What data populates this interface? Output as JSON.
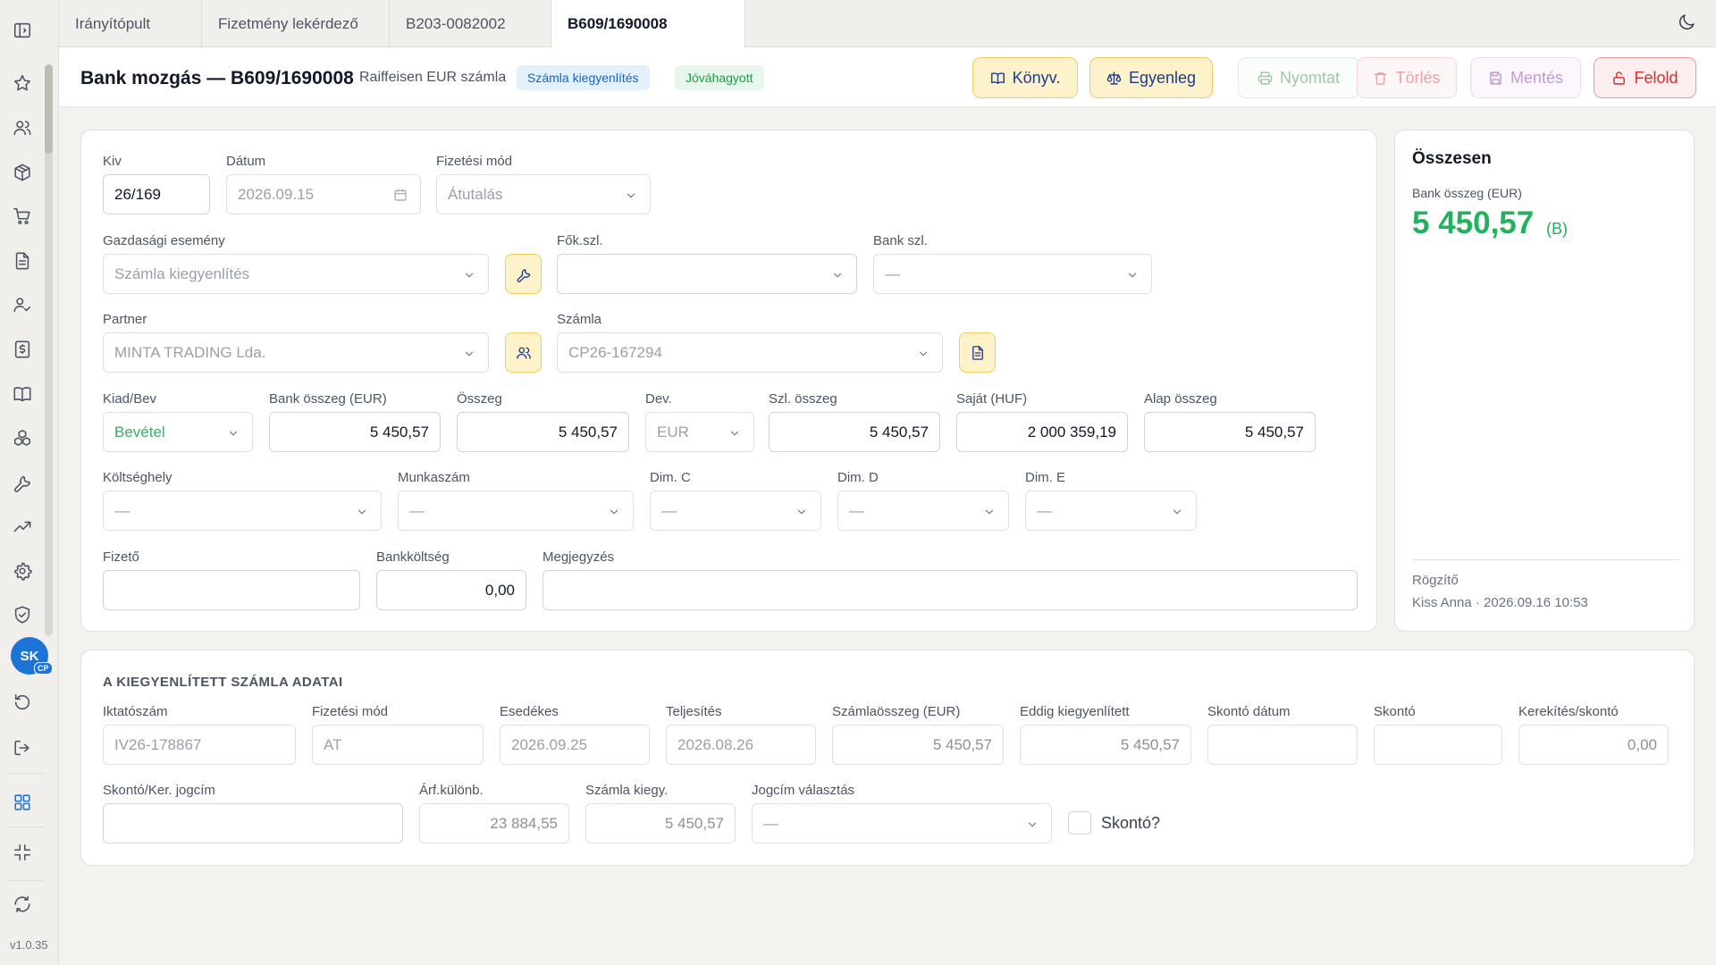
{
  "tabs": [
    "Irányítópult",
    "Fizetmény lekérdező",
    "B203-0082002",
    "B609/1690008"
  ],
  "header": {
    "title": "Bank mozgás — B609/1690008",
    "subtitle": "Raiffeisen EUR számla",
    "badge_type": "Számla kiegyenlítés",
    "badge_status": "Jóváhagyott"
  },
  "actions": {
    "konyv": "Könyv.",
    "egyenleg": "Egyenleg",
    "nyomtat": "Nyomtat",
    "torles": "Törlés",
    "mentes": "Mentés",
    "felold": "Felold"
  },
  "form": {
    "kiv": {
      "label": "Kiv",
      "value": "26/169"
    },
    "datum": {
      "label": "Dátum",
      "value": "2026.09.15"
    },
    "fizmod": {
      "label": "Fizetési mód",
      "value": "Átutalás"
    },
    "gazd": {
      "label": "Gazdasági esemény",
      "value": "Számla kiegyenlítés"
    },
    "fokszl": {
      "label": "Fők.szl.",
      "value": ""
    },
    "bankszl": {
      "label": "Bank szl.",
      "value": "—"
    },
    "partner": {
      "label": "Partner",
      "value": "MINTA TRADING Lda."
    },
    "szamla": {
      "label": "Számla",
      "value": "CP26-167294"
    },
    "kiadbev": {
      "label": "Kiad/Bev",
      "value": "Bevétel"
    },
    "bankosszeg": {
      "label": "Bank összeg (EUR)",
      "value": "5 450,57"
    },
    "osszeg": {
      "label": "Összeg",
      "value": "5 450,57"
    },
    "dev": {
      "label": "Dev.",
      "value": "EUR"
    },
    "szlosszeg": {
      "label": "Szl. összeg",
      "value": "5 450,57"
    },
    "sajat": {
      "label": "Saját (HUF)",
      "value": "2 000 359,19"
    },
    "alaposszeg": {
      "label": "Alap összeg",
      "value": "5 450,57"
    },
    "koltseghely": {
      "label": "Költséghely",
      "value": "—"
    },
    "munkaszam": {
      "label": "Munkaszám",
      "value": "—"
    },
    "dimc": {
      "label": "Dim. C",
      "value": "—"
    },
    "dimd": {
      "label": "Dim. D",
      "value": "—"
    },
    "dime": {
      "label": "Dim. E",
      "value": "—"
    },
    "fizeto": {
      "label": "Fizető",
      "value": ""
    },
    "bankkoltseg": {
      "label": "Bankköltség",
      "value": "0,00"
    },
    "megjegyzes": {
      "label": "Megjegyzés",
      "value": ""
    }
  },
  "summary": {
    "title": "Összesen",
    "label": "Bank összeg (EUR)",
    "value": "5 450,57",
    "suffix": "(B)",
    "rec_label": "Rögzítő",
    "rec_value": "Kiss Anna · 2026.09.16 10:53"
  },
  "invoice": {
    "title": "A KIEGYENLÍTETT SZÁMLA ADATAI",
    "iktato": {
      "label": "Iktatószám",
      "value": "IV26-178867"
    },
    "fizmod": {
      "label": "Fizetési mód",
      "value": "AT"
    },
    "esedekes": {
      "label": "Esedékes",
      "value": "2026.09.25"
    },
    "teljesites": {
      "label": "Teljesítés",
      "value": "2026.08.26"
    },
    "szamlaosszeg": {
      "label": "Számlaösszeg (EUR)",
      "value": "5 450,57"
    },
    "eddig": {
      "label": "Eddig kiegyenlített",
      "value": "5 450,57"
    },
    "skontodatum": {
      "label": "Skontó dátum",
      "value": ""
    },
    "skonto": {
      "label": "Skontó",
      "value": ""
    },
    "kerekites": {
      "label": "Kerekítés/skontó",
      "value": "0,00"
    },
    "jogcim": {
      "label": "Skontó/Ker. jogcím",
      "value": ""
    },
    "arfkul": {
      "label": "Árf.különb.",
      "value": "23 884,55"
    },
    "szamlakiegy": {
      "label": "Számla kiegy.",
      "value": "5 450,57"
    },
    "jogcimval": {
      "label": "Jogcím választás",
      "value": "—"
    },
    "skontocheck": "Skontó?"
  },
  "sidebar": {
    "avatar": "SK",
    "avatar_badge": "CP",
    "version": "v1.0.35"
  }
}
